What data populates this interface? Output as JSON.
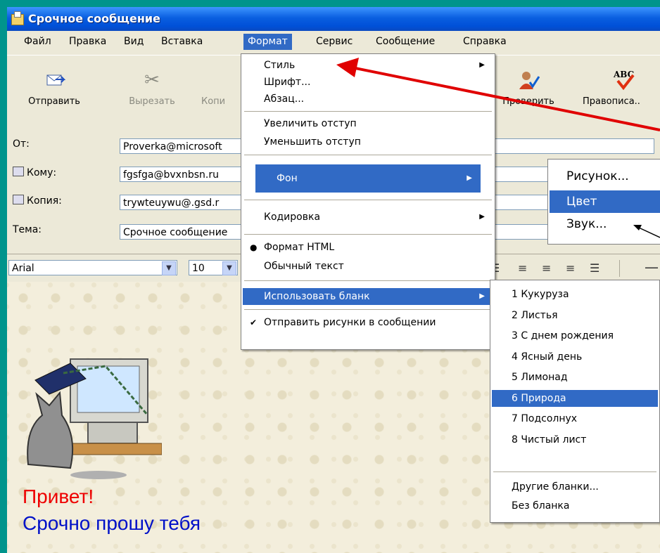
{
  "window": {
    "title": "Срочное сообщение"
  },
  "menubar": {
    "items": [
      "Файл",
      "Правка",
      "Вид",
      "Вставка",
      "Формат",
      "Сервис",
      "Сообщение",
      "Справка"
    ]
  },
  "toolbar": {
    "send": "Отправить",
    "cut": "Вырезать",
    "copy": "Копи",
    "check": "Проверить",
    "spelling": "Правописа..",
    "abc": "ABC"
  },
  "headers": {
    "from_label": "От:",
    "from_value": "Proverka@microsoft",
    "to_label": "Кому:",
    "to_value": "fgsfga@bvxnbsn.ru",
    "cc_label": "Копия:",
    "cc_value": "trywteuywu@.gsd.r",
    "subject_label": "Тема:",
    "subject_value": "Срочное сообщение"
  },
  "format_bar": {
    "font": "Arial",
    "size": "10"
  },
  "format_menu": {
    "style": "Стиль",
    "font": "Шрифт...",
    "paragraph": "Абзац...",
    "increase_indent": "Увеличить отступ",
    "decrease_indent": "Уменьшить отступ",
    "background": "Фон",
    "encoding": "Кодировка",
    "html_format": "Формат HTML",
    "plain_text": "Обычный текст",
    "use_stationery": "Использовать бланк",
    "send_pictures": "Отправить рисунки в сообщении"
  },
  "background_menu": {
    "picture": "Рисунок...",
    "color": "Цвет",
    "sound": "Звук..."
  },
  "stationery_menu": {
    "items": [
      "1 Кукуруза",
      "2 Листья",
      "3 С днем рождения",
      "4 Ясный день",
      "5 Лимонад",
      "6 Природа",
      "7 Подсолнух",
      "8 Чистый лист"
    ],
    "selected_index": 5,
    "more": "Другие бланки...",
    "none": "Без бланка"
  },
  "body": {
    "line1": "Привет!",
    "line2": "Срочно прошу тебя"
  },
  "colors": {
    "accent": "#316ac5",
    "arrow": "#e00000",
    "greeting": "#e00000",
    "text": "#0010c8"
  }
}
